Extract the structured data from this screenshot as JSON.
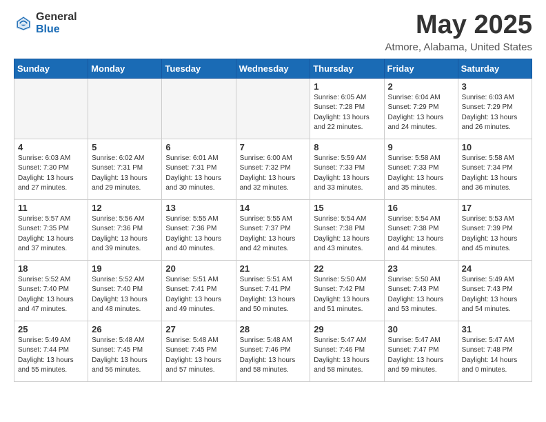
{
  "logo": {
    "general": "General",
    "blue": "Blue"
  },
  "title": "May 2025",
  "location": "Atmore, Alabama, United States",
  "weekdays": [
    "Sunday",
    "Monday",
    "Tuesday",
    "Wednesday",
    "Thursday",
    "Friday",
    "Saturday"
  ],
  "weeks": [
    [
      {
        "day": "",
        "info": ""
      },
      {
        "day": "",
        "info": ""
      },
      {
        "day": "",
        "info": ""
      },
      {
        "day": "",
        "info": ""
      },
      {
        "day": "1",
        "info": "Sunrise: 6:05 AM\nSunset: 7:28 PM\nDaylight: 13 hours\nand 22 minutes."
      },
      {
        "day": "2",
        "info": "Sunrise: 6:04 AM\nSunset: 7:29 PM\nDaylight: 13 hours\nand 24 minutes."
      },
      {
        "day": "3",
        "info": "Sunrise: 6:03 AM\nSunset: 7:29 PM\nDaylight: 13 hours\nand 26 minutes."
      }
    ],
    [
      {
        "day": "4",
        "info": "Sunrise: 6:03 AM\nSunset: 7:30 PM\nDaylight: 13 hours\nand 27 minutes."
      },
      {
        "day": "5",
        "info": "Sunrise: 6:02 AM\nSunset: 7:31 PM\nDaylight: 13 hours\nand 29 minutes."
      },
      {
        "day": "6",
        "info": "Sunrise: 6:01 AM\nSunset: 7:31 PM\nDaylight: 13 hours\nand 30 minutes."
      },
      {
        "day": "7",
        "info": "Sunrise: 6:00 AM\nSunset: 7:32 PM\nDaylight: 13 hours\nand 32 minutes."
      },
      {
        "day": "8",
        "info": "Sunrise: 5:59 AM\nSunset: 7:33 PM\nDaylight: 13 hours\nand 33 minutes."
      },
      {
        "day": "9",
        "info": "Sunrise: 5:58 AM\nSunset: 7:33 PM\nDaylight: 13 hours\nand 35 minutes."
      },
      {
        "day": "10",
        "info": "Sunrise: 5:58 AM\nSunset: 7:34 PM\nDaylight: 13 hours\nand 36 minutes."
      }
    ],
    [
      {
        "day": "11",
        "info": "Sunrise: 5:57 AM\nSunset: 7:35 PM\nDaylight: 13 hours\nand 37 minutes."
      },
      {
        "day": "12",
        "info": "Sunrise: 5:56 AM\nSunset: 7:36 PM\nDaylight: 13 hours\nand 39 minutes."
      },
      {
        "day": "13",
        "info": "Sunrise: 5:55 AM\nSunset: 7:36 PM\nDaylight: 13 hours\nand 40 minutes."
      },
      {
        "day": "14",
        "info": "Sunrise: 5:55 AM\nSunset: 7:37 PM\nDaylight: 13 hours\nand 42 minutes."
      },
      {
        "day": "15",
        "info": "Sunrise: 5:54 AM\nSunset: 7:38 PM\nDaylight: 13 hours\nand 43 minutes."
      },
      {
        "day": "16",
        "info": "Sunrise: 5:54 AM\nSunset: 7:38 PM\nDaylight: 13 hours\nand 44 minutes."
      },
      {
        "day": "17",
        "info": "Sunrise: 5:53 AM\nSunset: 7:39 PM\nDaylight: 13 hours\nand 45 minutes."
      }
    ],
    [
      {
        "day": "18",
        "info": "Sunrise: 5:52 AM\nSunset: 7:40 PM\nDaylight: 13 hours\nand 47 minutes."
      },
      {
        "day": "19",
        "info": "Sunrise: 5:52 AM\nSunset: 7:40 PM\nDaylight: 13 hours\nand 48 minutes."
      },
      {
        "day": "20",
        "info": "Sunrise: 5:51 AM\nSunset: 7:41 PM\nDaylight: 13 hours\nand 49 minutes."
      },
      {
        "day": "21",
        "info": "Sunrise: 5:51 AM\nSunset: 7:41 PM\nDaylight: 13 hours\nand 50 minutes."
      },
      {
        "day": "22",
        "info": "Sunrise: 5:50 AM\nSunset: 7:42 PM\nDaylight: 13 hours\nand 51 minutes."
      },
      {
        "day": "23",
        "info": "Sunrise: 5:50 AM\nSunset: 7:43 PM\nDaylight: 13 hours\nand 53 minutes."
      },
      {
        "day": "24",
        "info": "Sunrise: 5:49 AM\nSunset: 7:43 PM\nDaylight: 13 hours\nand 54 minutes."
      }
    ],
    [
      {
        "day": "25",
        "info": "Sunrise: 5:49 AM\nSunset: 7:44 PM\nDaylight: 13 hours\nand 55 minutes."
      },
      {
        "day": "26",
        "info": "Sunrise: 5:48 AM\nSunset: 7:45 PM\nDaylight: 13 hours\nand 56 minutes."
      },
      {
        "day": "27",
        "info": "Sunrise: 5:48 AM\nSunset: 7:45 PM\nDaylight: 13 hours\nand 57 minutes."
      },
      {
        "day": "28",
        "info": "Sunrise: 5:48 AM\nSunset: 7:46 PM\nDaylight: 13 hours\nand 58 minutes."
      },
      {
        "day": "29",
        "info": "Sunrise: 5:47 AM\nSunset: 7:46 PM\nDaylight: 13 hours\nand 58 minutes."
      },
      {
        "day": "30",
        "info": "Sunrise: 5:47 AM\nSunset: 7:47 PM\nDaylight: 13 hours\nand 59 minutes."
      },
      {
        "day": "31",
        "info": "Sunrise: 5:47 AM\nSunset: 7:48 PM\nDaylight: 14 hours\nand 0 minutes."
      }
    ]
  ]
}
